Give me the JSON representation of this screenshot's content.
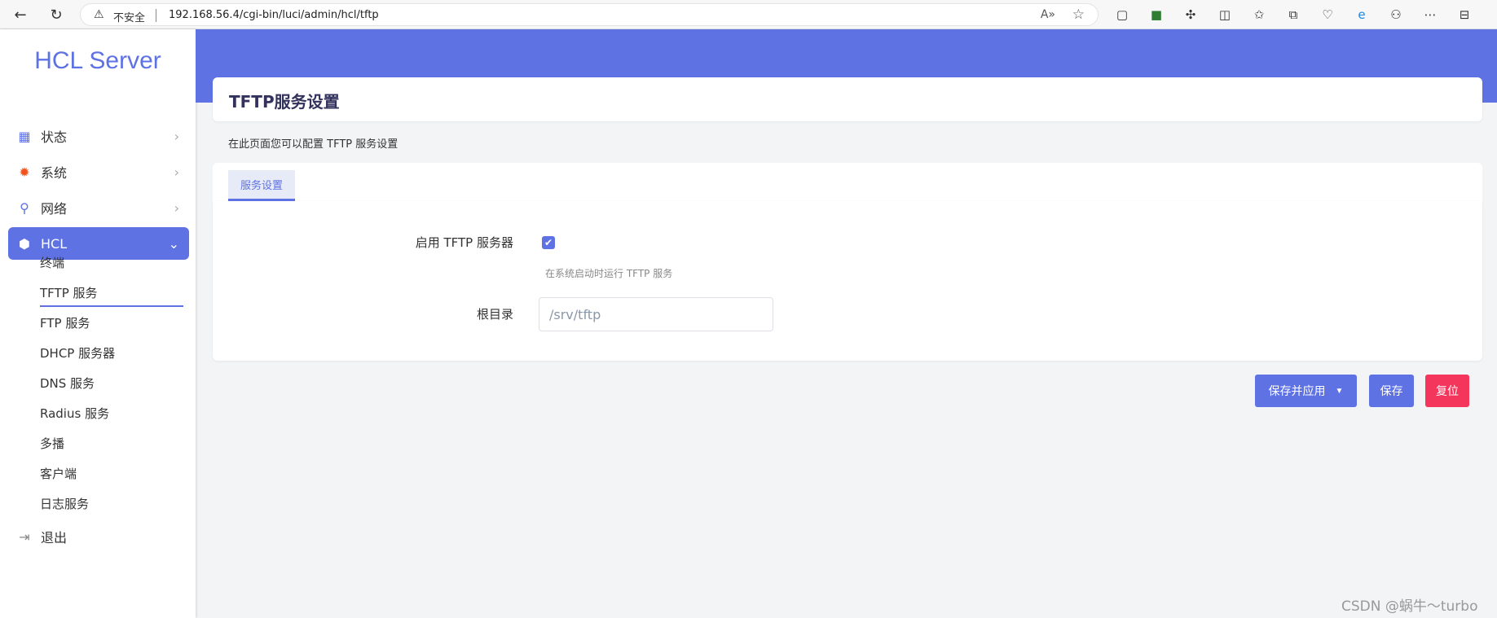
{
  "browser": {
    "insecure_label": "不安全",
    "url": "192.168.56.4/cgi-bin/luci/admin/hcl/tftp",
    "read_aloud_label": "Aͅ"
  },
  "sidebar": {
    "brand": "HCL Server",
    "menu": [
      {
        "label": "状态",
        "icon": "dashboard-icon"
      },
      {
        "label": "系统",
        "icon": "gear-icon"
      },
      {
        "label": "网络",
        "icon": "network-icon"
      },
      {
        "label": "HCL",
        "icon": "cube-icon"
      }
    ],
    "submenu": [
      {
        "label": "终端"
      },
      {
        "label": "TFTP 服务"
      },
      {
        "label": "FTP 服务"
      },
      {
        "label": "DHCP 服务器"
      },
      {
        "label": "DNS 服务"
      },
      {
        "label": "Radius 服务"
      },
      {
        "label": "多播"
      },
      {
        "label": "客户端"
      },
      {
        "label": "日志服务"
      }
    ],
    "logout": {
      "label": "退出",
      "icon": "logout-icon"
    }
  },
  "main": {
    "title": "TFTP服务设置",
    "description": "在此页面您可以配置 TFTP 服务设置",
    "tabs": [
      {
        "label": "服务设置"
      }
    ],
    "form": {
      "enable_label": "启用 TFTP 服务器",
      "enable_checked": true,
      "enable_hint": "在系统启动时运行 TFTP 服务",
      "root_label": "根目录",
      "root_value": "/srv/tftp"
    },
    "actions": {
      "save_apply": "保存并应用",
      "save": "保存",
      "reset": "复位"
    }
  },
  "watermark": "CSDN @蜗牛～turbo",
  "colors": {
    "accent": "#5e72e4",
    "danger": "#f5365c",
    "background": "#f3f4f6"
  }
}
